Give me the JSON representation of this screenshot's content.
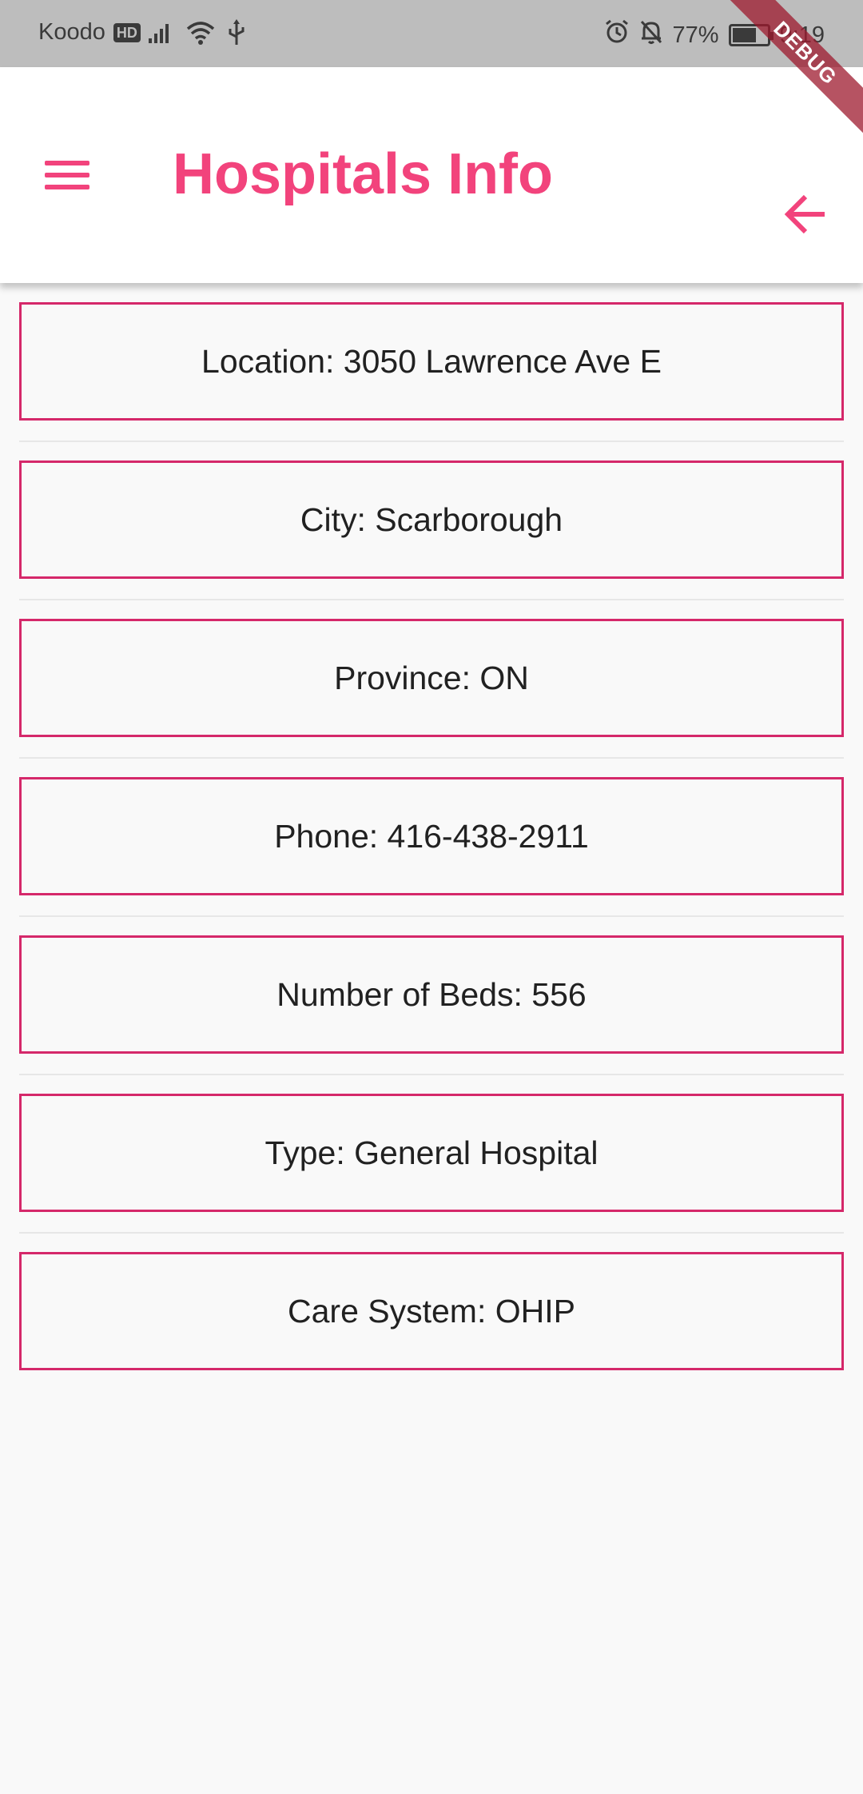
{
  "status_bar": {
    "carrier": "Koodo",
    "hd_badge": "HD",
    "battery_percent": "77%",
    "time": "9:19",
    "battery_level": 0.77
  },
  "debug_banner": "DEBUG",
  "app_bar": {
    "title": "Hospitals Info",
    "menu_icon": "menu-icon",
    "back_icon": "arrow-back-icon",
    "accent_color": "#f2437c"
  },
  "info_items": [
    {
      "text": "Location: 3050 Lawrence Ave E"
    },
    {
      "text": "City: Scarborough"
    },
    {
      "text": "Province: ON"
    },
    {
      "text": "Phone: 416-438-2911"
    },
    {
      "text": "Number of Beds: 556"
    },
    {
      "text": "Type: General Hospital"
    },
    {
      "text": "Care System: OHIP"
    }
  ],
  "colors": {
    "border": "#d5286a",
    "background": "#f9f9f9",
    "status_bar": "#bdbdbd"
  }
}
